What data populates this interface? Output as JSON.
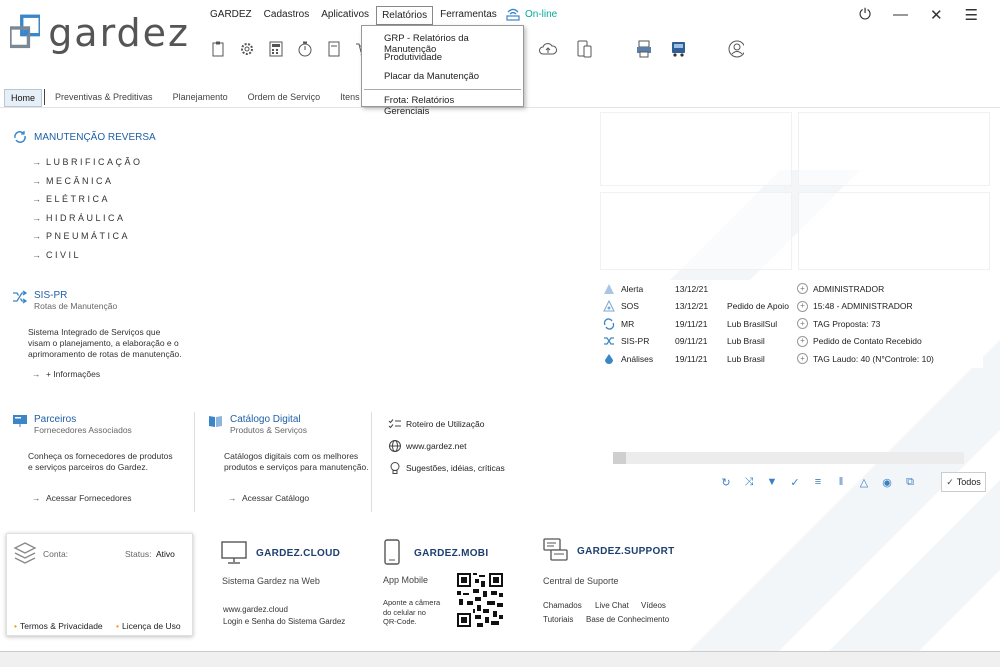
{
  "app": {
    "logo_text": "gardez"
  },
  "menu": {
    "items": [
      "GARDEZ",
      "Cadastros",
      "Aplicativos",
      "Relatórios",
      "Ferramentas"
    ],
    "status": "On-line"
  },
  "dropdown": {
    "items": [
      "GRP - Relatórios da Manutenção",
      "Produtividade",
      "Placar da Manutenção",
      "Frota: Relatórios Gerenciais"
    ]
  },
  "tabs": [
    "Home",
    "Preventivas & Preditivas",
    "Planejamento",
    "Ordem de Serviço",
    "Itens da O.S"
  ],
  "manutencao": {
    "title": "MANUTENÇÃO REVERSA",
    "items": [
      "LUBRIFICAÇÃO",
      "MECÂNICA",
      "ELÉTRICA",
      "HIDRÁULICA",
      "PNEUMÁTICA",
      "CIVIL"
    ]
  },
  "sispr": {
    "title": "SIS-PR",
    "subtitle": "Rotas de Manutenção",
    "desc": [
      "Sistema Integrado de Serviços que",
      "visam o planejamento, a elaboração e o",
      "aprimoramento de rotas de manutenção."
    ],
    "link": "+ Informações"
  },
  "parceiros": {
    "title": "Parceiros",
    "subtitle": "Fornecedores Associados",
    "desc": [
      "Conheça os fornecedores de produtos",
      "e serviços parceiros do Gardez."
    ],
    "link": "Acessar Fornecedores"
  },
  "catalogo": {
    "title": "Catálogo Digital",
    "subtitle": "Produtos & Serviços",
    "desc": [
      "Catálogos digitais com os melhores",
      "produtos e serviços para manutenção."
    ],
    "link": "Acessar Catálogo"
  },
  "links": [
    "Roteiro de Utilização",
    "www.gardez.net",
    "Sugestões, idéias, críticas"
  ],
  "events": [
    {
      "type": "Alerta",
      "date": "13/12/21",
      "desc": "",
      "detail": "ADMINISTRADOR"
    },
    {
      "type": "SOS",
      "date": "13/12/21",
      "desc": "Pedido de Apoio",
      "detail": "15:48 - ADMINISTRADOR"
    },
    {
      "type": "MR",
      "date": "19/11/21",
      "desc": "Lub  BrasilSul",
      "detail": "TAG Proposta: 73"
    },
    {
      "type": "SIS-PR",
      "date": "09/11/21",
      "desc": "Lub  Brasil",
      "detail": "Pedido de Contato Recebido"
    },
    {
      "type": "Análises",
      "date": "19/11/21",
      "desc": "Lub  Brasil",
      "detail": "TAG Laudo: 40 (N°Controle: 10)"
    }
  ],
  "filter": {
    "todos_label": "Todos"
  },
  "conta": {
    "label": "Conta:",
    "status_label": "Status:",
    "status_value": "Ativo",
    "terms": "Termos & Privacidade",
    "license": "Licença de Uso"
  },
  "cloud": {
    "title": "GARDEZ.CLOUD",
    "subtitle": "Sistema Gardez na Web",
    "lines": [
      "www.gardez.cloud",
      "Login e Senha do Sistema Gardez"
    ]
  },
  "mobi": {
    "title": "GARDEZ.MOBI",
    "subtitle": "App Mobile",
    "lines": [
      "Aponte a câmera",
      "do celular no",
      "QR-Code."
    ]
  },
  "support": {
    "title": "GARDEZ.SUPPORT",
    "subtitle": "Central de Suporte",
    "links_row1": [
      "Chamados",
      "Live Chat",
      "Vídeos"
    ],
    "links_row2": [
      "Tutoriais",
      "Base de Conhecimento"
    ]
  },
  "colors": {
    "accent": "#1f5fa8",
    "online": "#00a99d",
    "footer_title": "#1f3f6f",
    "bullet": "#f29400"
  }
}
